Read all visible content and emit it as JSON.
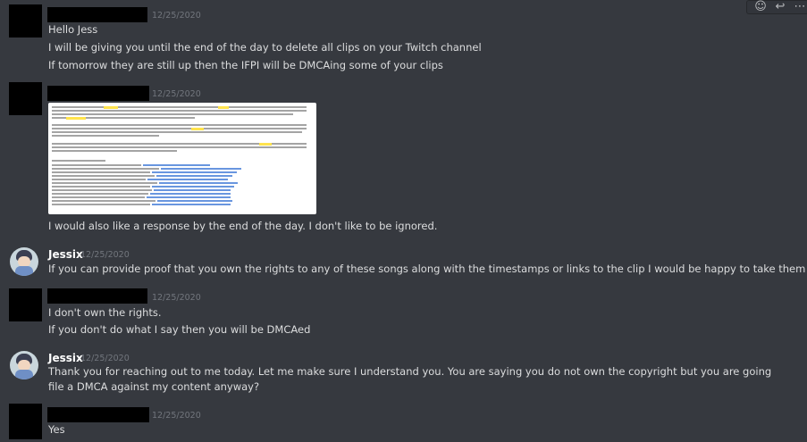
{
  "toolbar": {
    "icons": [
      "add-reaction-icon",
      "reply-icon",
      "more-icon"
    ],
    "add_reaction_glyph": "☺",
    "reply_glyph": "↩",
    "more_glyph": "⋯"
  },
  "messages": [
    {
      "author": "",
      "timestamp": "12/25/2020",
      "lines": [
        "Hello Jess",
        "I will be giving you until the end of the day to delete all clips on your Twitch channel",
        "If tomorrow they are still up then the IFPI will be DMCAing some of your clips"
      ]
    },
    {
      "author": "",
      "timestamp": "12/25/2020",
      "lines": [
        "I would also like a response by the end of the day. I don't like to be ignored."
      ]
    },
    {
      "author": "Jessix",
      "timestamp": "12/25/2020",
      "lines": [
        "If you  can provide proof that you own the rights to any of these songs along with the timestamps or links to the clip  I would be happy to take them down."
      ]
    },
    {
      "author": "",
      "timestamp": "12/25/2020",
      "lines": [
        "I don't own the rights.",
        "If you don't do what I say then you will be DMCAed"
      ]
    },
    {
      "author": "Jessix",
      "timestamp": "12/25/2020",
      "lines": [
        "Thank you for reaching out to me today. Let me make sure I understand you.  You are saying you do not own the copyright but you are going file a DMCA against my content anyway?"
      ]
    },
    {
      "author": "",
      "timestamp": "12/25/2020",
      "lines": [
        "Yes"
      ]
    }
  ],
  "colors": {
    "background": "#36393f",
    "text": "#dcddde",
    "timestamp": "#72767d",
    "username": "#ffffff",
    "redaction": "#000000"
  }
}
